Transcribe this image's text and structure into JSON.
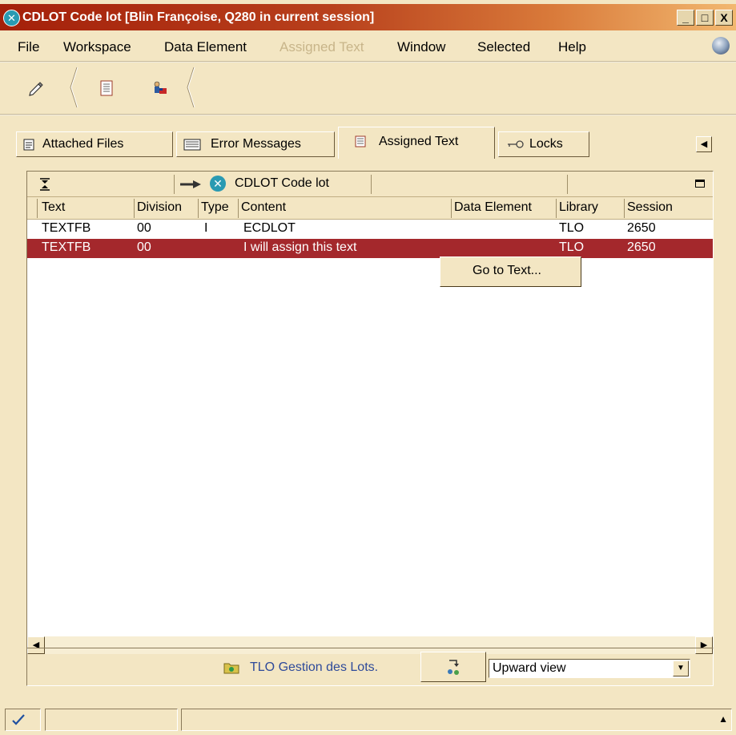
{
  "window": {
    "title": "CDLOT Code lot [Blin Françoise, Q280 in current session]",
    "app_icon": "x-circle-icon",
    "minimize": "_",
    "maximize": "□",
    "close": "X"
  },
  "menu": {
    "items": [
      {
        "label": "File",
        "enabled": true
      },
      {
        "label": "Workspace",
        "enabled": true
      },
      {
        "label": "Data Element",
        "enabled": true
      },
      {
        "label": "Assigned Text",
        "enabled": false
      },
      {
        "label": "Window",
        "enabled": true
      },
      {
        "label": "Selected",
        "enabled": true
      },
      {
        "label": "Help",
        "enabled": true
      }
    ]
  },
  "toolbar": {
    "icons": [
      "pencil-icon",
      "document-icon",
      "person-flag-icon"
    ]
  },
  "tabs": [
    {
      "label": "Attached Files",
      "icon": "document-icon",
      "active": false
    },
    {
      "label": "Error Messages",
      "icon": "list-icon",
      "active": false
    },
    {
      "label": "Assigned Text",
      "icon": "text-document-icon",
      "active": true
    },
    {
      "label": "Locks",
      "icon": "key-icon",
      "active": false
    }
  ],
  "panel": {
    "header_title": "CDLOT Code lot",
    "header_icon": "x-circle-icon"
  },
  "table": {
    "columns": [
      "Text",
      "Division",
      "Type",
      "Content",
      "Data Element",
      "Library",
      "Session"
    ],
    "rows": [
      {
        "text": "TEXTFB",
        "division": "00",
        "type": "I",
        "content": "ECDLOT",
        "data_element": "",
        "library": "TLO",
        "session": "2650",
        "selected": false
      },
      {
        "text": "TEXTFB",
        "division": "00",
        "type": "",
        "content": "I will assign this text",
        "data_element": "",
        "library": "TLO",
        "session": "2650",
        "selected": true
      }
    ]
  },
  "context_menu": {
    "items": [
      "Go to Text..."
    ]
  },
  "bottom": {
    "library_label": "TLO Gestion des Lots.",
    "view_selected": "Upward view"
  },
  "colors": {
    "background": "#f3e6c3",
    "title_start": "#a4200a",
    "title_end": "#f2b870",
    "selection": "#a4282c",
    "link": "#2e4a9a"
  }
}
